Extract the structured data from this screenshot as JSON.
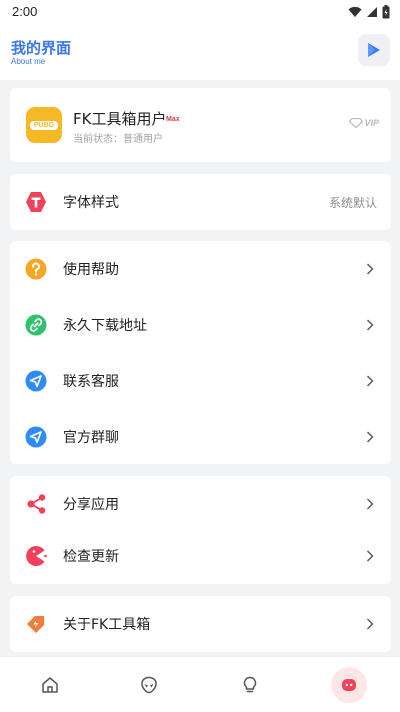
{
  "status_bar": {
    "time": "2:00"
  },
  "header": {
    "title": "我的界面",
    "subtitle": "About me"
  },
  "profile": {
    "app_icon_text": "PUBG",
    "username": "FK工具箱用户",
    "badge": "Max",
    "status": "当前状态：普通用户",
    "vip_label": "VIP"
  },
  "font_style": {
    "label": "字体样式",
    "value": "系统默认",
    "icon_letter": "T"
  },
  "menu_group_1": [
    {
      "label": "使用帮助",
      "icon": "help-icon"
    },
    {
      "label": "永久下载地址",
      "icon": "link-icon"
    },
    {
      "label": "联系客服",
      "icon": "send-icon"
    },
    {
      "label": "官方群聊",
      "icon": "send-icon"
    }
  ],
  "menu_group_2": [
    {
      "label": "分享应用",
      "icon": "share-icon"
    },
    {
      "label": "检查更新",
      "icon": "pacman-icon"
    }
  ],
  "menu_group_3": [
    {
      "label": "关于FK工具箱",
      "icon": "tag-icon"
    }
  ],
  "colors": {
    "accent": "#3b77f0",
    "font_icon": "#f0405a",
    "help_icon": "#f5a623",
    "link_icon": "#2dc26b",
    "send_icon": "#2f8cf5",
    "share_icon": "#f0405a",
    "update_icon": "#f0405a",
    "about_icon": "#f27a3a"
  },
  "tabbar": [
    {
      "name": "home-icon"
    },
    {
      "name": "alien-icon"
    },
    {
      "name": "bulb-icon"
    },
    {
      "name": "profile-icon",
      "active": true
    }
  ]
}
